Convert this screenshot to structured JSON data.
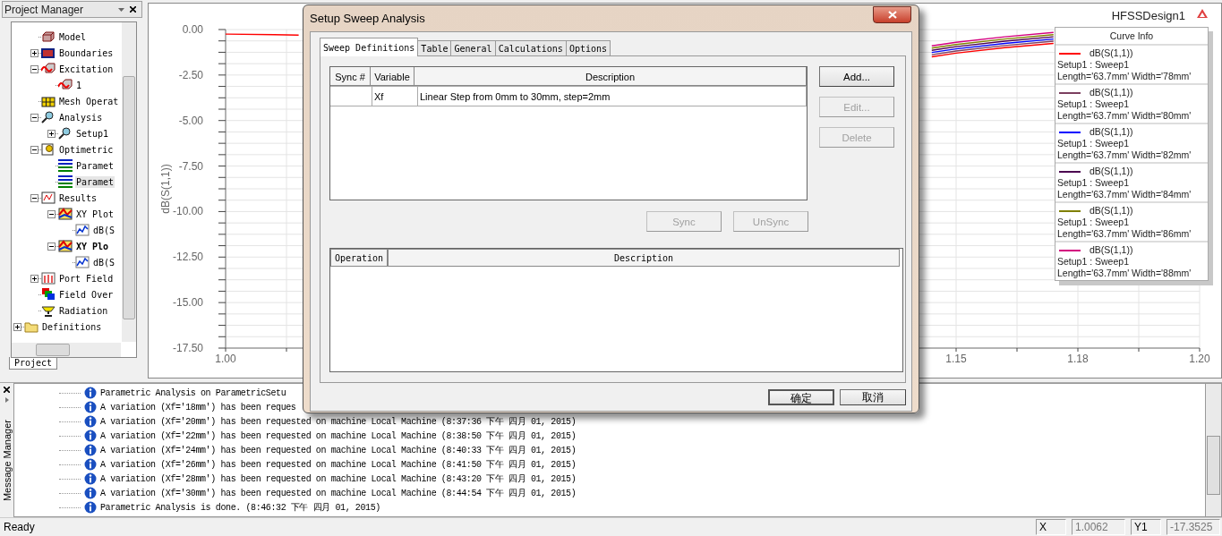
{
  "project": {
    "title": "Project Manager",
    "tab": "Project",
    "tree": [
      {
        "children": [
          {
            "label": "Model",
            "kind": "model",
            "selected": false
          },
          {
            "label": "Boundaries",
            "kind": "boundary",
            "expanded": false,
            "selected": false
          },
          {
            "label": "Excitation",
            "kind": "excitation",
            "expanded": true,
            "selected": false,
            "children": [
              {
                "label": "1",
                "kind": "excitation",
                "selected": false
              }
            ]
          },
          {
            "label": "Mesh Operat",
            "kind": "mesh",
            "selected": false
          },
          {
            "label": "Analysis",
            "kind": "analysis",
            "expanded": true,
            "selected": false,
            "children": [
              {
                "label": "Setup1",
                "kind": "analysis",
                "expanded": false,
                "selected": false
              }
            ]
          },
          {
            "label": "Optimetric",
            "kind": "optimetrics",
            "expanded": true,
            "selected": false,
            "children": [
              {
                "label": "Paramet",
                "kind": "parametric",
                "selected": false
              },
              {
                "label": "Paramet",
                "kind": "parametric",
                "selected": true
              }
            ]
          },
          {
            "label": "Results",
            "kind": "results",
            "expanded": true,
            "selected": false,
            "children": [
              {
                "label": "XY Plot",
                "kind": "plot",
                "expanded": true,
                "selected": false,
                "active": false,
                "children": [
                  {
                    "label": "dB(S",
                    "kind": "trace",
                    "selected": false
                  }
                ]
              },
              {
                "label": "XY Plo",
                "kind": "plot",
                "expanded": true,
                "selected": false,
                "active": true,
                "children": [
                  {
                    "label": "dB(S",
                    "kind": "trace",
                    "selected": false
                  }
                ]
              }
            ]
          },
          {
            "label": "Port Field",
            "kind": "portfield",
            "expanded": false,
            "selected": false
          },
          {
            "label": "Field Over",
            "kind": "overlay",
            "selected": false
          },
          {
            "label": "Radiation",
            "kind": "radiation",
            "selected": false
          }
        ]
      },
      {
        "label": "Definitions",
        "kind": "folder",
        "expanded": false,
        "selected": false
      }
    ]
  },
  "plot": {
    "design": "HFSSDesign1",
    "chart_data": {
      "type": "line",
      "grid": true,
      "ylabel": "dB(S(1,1))",
      "x": [
        1.0,
        1.01,
        1.015,
        1.145,
        1.15,
        1.16,
        1.17
      ],
      "xlim": [
        1.0,
        1.2
      ],
      "ylim": [
        -17.5,
        0
      ],
      "xticks": [
        {
          "value": 1.0,
          "label": "1.00"
        },
        {
          "value": 1.15,
          "label": "1.15"
        },
        {
          "value": 1.175,
          "label": "1.18"
        },
        {
          "value": 1.2,
          "label": "1.20"
        }
      ],
      "yticks": [
        {
          "value": 0,
          "label": "0.00"
        },
        {
          "value": -2.5,
          "label": "-2.50"
        },
        {
          "value": -5,
          "label": "-5.00"
        },
        {
          "value": -7.5,
          "label": "-7.50"
        },
        {
          "value": -10,
          "label": "-10.00"
        },
        {
          "value": -12.5,
          "label": "-12.50"
        },
        {
          "value": -15,
          "label": "-15.00"
        },
        {
          "value": -17.5,
          "label": "-17.50"
        }
      ],
      "series": [
        {
          "color": "#ff0000",
          "values": [
            -0.25,
            -0.28,
            -0.31,
            -1.5,
            -1.3,
            -1.0,
            -0.76
          ]
        },
        {
          "color": "#7b3f5f",
          "values": [
            null,
            null,
            null,
            -1.38,
            -1.18,
            -0.88,
            -0.64
          ]
        },
        {
          "color": "#0000ff",
          "values": [
            null,
            null,
            null,
            -1.26,
            -1.06,
            -0.76,
            -0.52
          ]
        },
        {
          "color": "#4b0050",
          "values": [
            null,
            null,
            null,
            -1.14,
            -0.94,
            -0.64,
            -0.4
          ]
        },
        {
          "color": "#808000",
          "values": [
            null,
            null,
            null,
            -1.02,
            -0.82,
            -0.52,
            -0.28
          ]
        },
        {
          "color": "#d4007f",
          "values": [
            null,
            null,
            null,
            -0.9,
            -0.7,
            -0.4,
            -0.16
          ]
        }
      ]
    },
    "curve_info": {
      "title": "Curve Info",
      "entries": [
        {
          "trace": "dB(S(1,1))",
          "solution": "Setup1 : Sweep1",
          "variation": "Length='63.7mm' Width='78mm'",
          "color": "#ff0000"
        },
        {
          "trace": "dB(S(1,1))",
          "solution": "Setup1 : Sweep1",
          "variation": "Length='63.7mm' Width='80mm'",
          "color": "#7b3f5f"
        },
        {
          "trace": "dB(S(1,1))",
          "solution": "Setup1 : Sweep1",
          "variation": "Length='63.7mm' Width='82mm'",
          "color": "#0000ff"
        },
        {
          "trace": "dB(S(1,1))",
          "solution": "Setup1 : Sweep1",
          "variation": "Length='63.7mm' Width='84mm'",
          "color": "#4b0050"
        },
        {
          "trace": "dB(S(1,1))",
          "solution": "Setup1 : Sweep1",
          "variation": "Length='63.7mm' Width='86mm'",
          "color": "#808000"
        },
        {
          "trace": "dB(S(1,1))",
          "solution": "Setup1 : Sweep1",
          "variation": "Length='63.7mm' Width='88mm'",
          "color": "#d4007f"
        }
      ]
    }
  },
  "dialog": {
    "title": "Setup Sweep Analysis",
    "tabs": [
      {
        "label": "Sweep Definitions",
        "selected": true
      },
      {
        "label": "Table",
        "selected": false
      },
      {
        "label": "General",
        "selected": false
      },
      {
        "label": "Calculations",
        "selected": false
      },
      {
        "label": "Options",
        "selected": false
      }
    ],
    "sweeps": {
      "columns": [
        "Sync #",
        "Variable",
        "Description"
      ],
      "rows": [
        [
          "",
          "Xf",
          "Linear Step from 0mm to 30mm, step=2mm"
        ]
      ]
    },
    "side_buttons": [
      {
        "label": "Add...",
        "disabled": false
      },
      {
        "label": "Edit...",
        "disabled": true
      },
      {
        "label": "Delete",
        "disabled": true
      }
    ],
    "sync_buttons": [
      {
        "label": "Sync",
        "disabled": true
      },
      {
        "label": "UnSync",
        "disabled": true
      }
    ],
    "operations": {
      "columns": [
        "Operation",
        "Description"
      ]
    },
    "buttons": [
      "确定",
      "取消"
    ]
  },
  "messages": {
    "title": "Message Manager",
    "items": [
      "Parametric Analysis on ParametricSetu",
      "A variation (Xf='18mm') has been reques",
      "A variation (Xf='20mm') has been requested on machine Local Machine (8:37:36 下午  四月 01, 2015)",
      "A variation (Xf='22mm') has been requested on machine Local Machine (8:38:50 下午  四月 01, 2015)",
      "A variation (Xf='24mm') has been requested on machine Local Machine (8:40:33 下午  四月 01, 2015)",
      "A variation (Xf='26mm') has been requested on machine Local Machine (8:41:50 下午  四月 01, 2015)",
      "A variation (Xf='28mm') has been requested on machine Local Machine (8:43:20 下午  四月 01, 2015)",
      "A variation (Xf='30mm') has been requested on machine Local Machine (8:44:54 下午  四月 01, 2015)",
      "Parametric Analysis is done. (8:46:32 下午  四月 01, 2015)"
    ]
  },
  "status_bar": {
    "text": "Ready",
    "x_label": "X",
    "x_value": "1.0062",
    "y_label": "Y1",
    "y_value": "-17.3525"
  }
}
